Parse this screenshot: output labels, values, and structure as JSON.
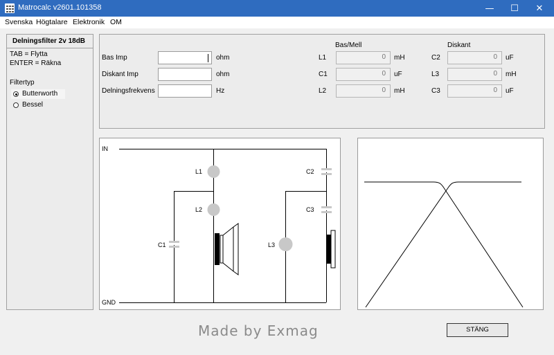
{
  "window": {
    "title": "Matrocalc v2601.101358",
    "minimize": "—",
    "maximize": "☐",
    "close": "✕"
  },
  "menu": [
    "Svenska",
    "Högtalare",
    "Elektronik",
    "OM"
  ],
  "sidebar": {
    "title": "Delningsfilter 2v 18dB",
    "hint_tab": "TAB    = Flytta",
    "hint_enter": "ENTER = Räkna",
    "filter_label": "Filtertyp",
    "options": [
      {
        "label": "Butterworth",
        "selected": true
      },
      {
        "label": "Bessel",
        "selected": false
      }
    ]
  },
  "inputs": {
    "bas_imp": {
      "label": "Bas Imp",
      "value": "",
      "unit": "ohm"
    },
    "diskant_imp": {
      "label": "Diskant Imp",
      "value": "",
      "unit": "ohm"
    },
    "delningsfrekvens": {
      "label": "Delningsfrekvens",
      "value": "",
      "unit": "Hz"
    }
  },
  "results": {
    "bas_header": "Bas/Mell",
    "diskant_header": "Diskant",
    "bas": [
      {
        "name": "L1",
        "value": "0",
        "unit": "mH"
      },
      {
        "name": "C1",
        "value": "0",
        "unit": "uF"
      },
      {
        "name": "L2",
        "value": "0",
        "unit": "mH"
      }
    ],
    "diskant": [
      {
        "name": "C2",
        "value": "0",
        "unit": "uF"
      },
      {
        "name": "L3",
        "value": "0",
        "unit": "mH"
      },
      {
        "name": "C3",
        "value": "0",
        "unit": "uF"
      }
    ]
  },
  "schematic": {
    "in": "IN",
    "gnd": "GND",
    "l1": "L1",
    "l2": "L2",
    "c1": "C1",
    "c2": "C2",
    "c3": "C3",
    "l3": "L3"
  },
  "footer": {
    "credit": "Made by Exmag",
    "close_button": "STÄNG"
  }
}
